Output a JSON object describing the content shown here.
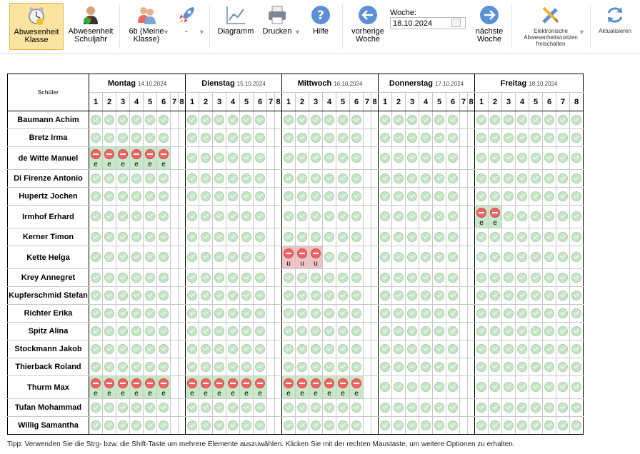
{
  "toolbar": {
    "abwesenheit_klasse": [
      "Abwesenheit",
      "Klasse"
    ],
    "abwesenheit_schuljahr": [
      "Abwesenheit",
      "Schuljahr"
    ],
    "class_select": [
      "6b (Meine",
      "Klasse)"
    ],
    "rocket_value": "-",
    "diagramm": "Diagramm",
    "drucken": "Drucken",
    "hilfe": "Hilfe",
    "prev_week": [
      "vorherige",
      "Woche"
    ],
    "woche_label": "Woche:",
    "woche_value": "18.10.2024",
    "next_week": [
      "nächste",
      "Woche"
    ],
    "notes": [
      "Elektronische",
      "Abwesenheitsnotizen",
      "freischalten"
    ],
    "refresh": "Aktualisieren"
  },
  "grid": {
    "corner_label": "Schüler",
    "periods": [
      "1",
      "2",
      "3",
      "4",
      "5",
      "6",
      "7",
      "8"
    ],
    "days": [
      {
        "name": "Montag",
        "date": "14.10.2024"
      },
      {
        "name": "Dienstag",
        "date": "15.10.2024"
      },
      {
        "name": "Mittwoch",
        "date": "16.10.2024"
      },
      {
        "name": "Donnerstag",
        "date": "17.10.2024"
      },
      {
        "name": "Freitag",
        "date": "18.10.2024"
      }
    ],
    "students": [
      {
        "name": "Baumann Achim",
        "cells": [
          "oooooo--",
          "oooooo--",
          "oooooo--",
          "oooooo--",
          "oooooooo"
        ]
      },
      {
        "name": "Bretz Irma",
        "cells": [
          "oooooo--",
          "oooooo--",
          "oooooo--",
          "oooooo--",
          "oooooooo"
        ]
      },
      {
        "name": "de Witte Manuel",
        "cells": [
          "eeeeee--",
          "oooooo--",
          "oooooo--",
          "oooooo--",
          "oooooooo"
        ]
      },
      {
        "name": "Di Firenze Antonio",
        "cells": [
          "oooooo--",
          "oooooo--",
          "oooooo--",
          "oooooo--",
          "oooooooo"
        ]
      },
      {
        "name": "Hupertz Jochen",
        "cells": [
          "oooooo--",
          "oooooo--",
          "oooooo--",
          "oooooo--",
          "oooooooo"
        ]
      },
      {
        "name": "Irmhof Erhard",
        "cells": [
          "oooooo--",
          "oooooo--",
          "oooooo--",
          "oooooo--",
          "eeoooooo"
        ]
      },
      {
        "name": "Kerner Timon",
        "cells": [
          "oooooo--",
          "oooooo--",
          "oooooo--",
          "oooooo--",
          "oooooooo"
        ]
      },
      {
        "name": "Kette Helga",
        "cells": [
          "oooooo--",
          "oooooo--",
          "uuuooo--",
          "oooooo--",
          "oooooooo"
        ]
      },
      {
        "name": "Krey Annegret",
        "cells": [
          "oooooo--",
          "oooooo--",
          "oooooo--",
          "oooooo--",
          "oooooooo"
        ]
      },
      {
        "name": "Kupferschmid Stefan",
        "cells": [
          "oooooo--",
          "oooooo--",
          "oooooo--",
          "oooooo--",
          "oooooooo"
        ]
      },
      {
        "name": "Richter Erika",
        "cells": [
          "oooooo--",
          "oooooo--",
          "oooooo--",
          "oooooo--",
          "oooooooo"
        ]
      },
      {
        "name": "Spitz Alina",
        "cells": [
          "oooooo--",
          "oooooo--",
          "oooooo--",
          "oooooo--",
          "oooooooo"
        ]
      },
      {
        "name": "Stockmann Jakob",
        "cells": [
          "oooooo--",
          "oooooo--",
          "oooooo--",
          "oooooo--",
          "oooooooo"
        ]
      },
      {
        "name": "Thierback Roland",
        "cells": [
          "oooooo--",
          "oooooo--",
          "oooooo--",
          "oooooo--",
          "oooooooo"
        ]
      },
      {
        "name": "Thurm Max",
        "cells": [
          "eeeeee--",
          "eeeeee--",
          "eeeeee--",
          "oooooo--",
          "oooooooo"
        ]
      },
      {
        "name": "Tufan Mohammad",
        "cells": [
          "oooooo--",
          "oooooo--",
          "oooooo--",
          "oooooo--",
          "oooooooo"
        ]
      },
      {
        "name": "Willig Samantha",
        "cells": [
          "oooooo--",
          "oooooo--",
          "oooooo--",
          "oooooo--",
          "oooooooo"
        ]
      }
    ],
    "absence_labels": {
      "e": "e",
      "u": "u"
    }
  },
  "tip": "Tipp: Verwenden Sie die Strg- bzw. die Shift-Taste um mehrere Elemente auszuwählen. Klicken Sie mit der rechten Maustaste, um weitere Optionen zu erhalten.",
  "colors": {
    "accent_active": "#fbe3a0",
    "excused": "#c9e8c9",
    "unexcused": "#eec4c6",
    "ok": "#c6e4c6",
    "absent": "#ec6565"
  }
}
